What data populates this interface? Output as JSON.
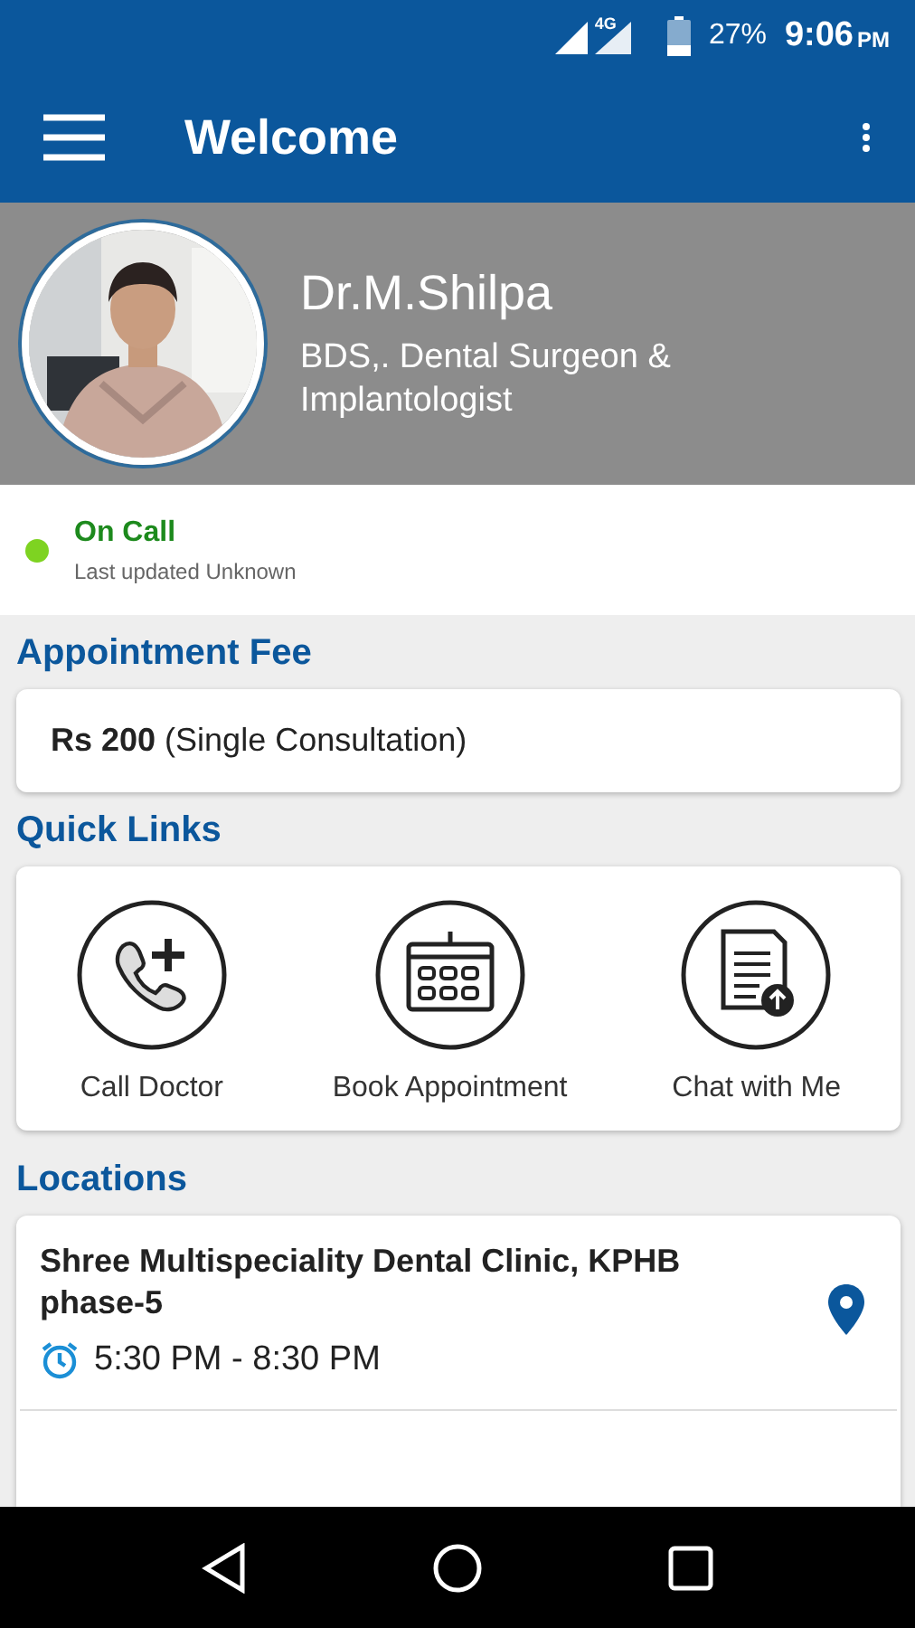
{
  "status_bar": {
    "network": "4G",
    "battery": "27%",
    "time": "9:06",
    "time_suffix": "PM"
  },
  "app_bar": {
    "title": "Welcome"
  },
  "profile": {
    "name": "Dr.M.Shilpa",
    "qualification": "BDS,. Dental Surgeon & Implantologist"
  },
  "availability": {
    "status": "On Call",
    "color": "#7ed321",
    "updated": "Last updated Unknown"
  },
  "appointment_fee": {
    "heading": "Appointment Fee",
    "text": "**Rs 200** (Single Consultation)"
  },
  "quick_links": {
    "heading": "Quick Links",
    "items": [
      {
        "kind": "call",
        "label": "Call Doctor"
      },
      {
        "kind": "calendar",
        "label": "Book Appointment"
      },
      {
        "kind": "document",
        "label": "Chat with Me"
      }
    ]
  },
  "locations": {
    "heading": "Locations",
    "items": [
      {
        "name": "Shree Multispeciality Dental Clinic, KPHB phase-5",
        "hours": "5:30 PM - 8:30 PM"
      }
    ]
  }
}
